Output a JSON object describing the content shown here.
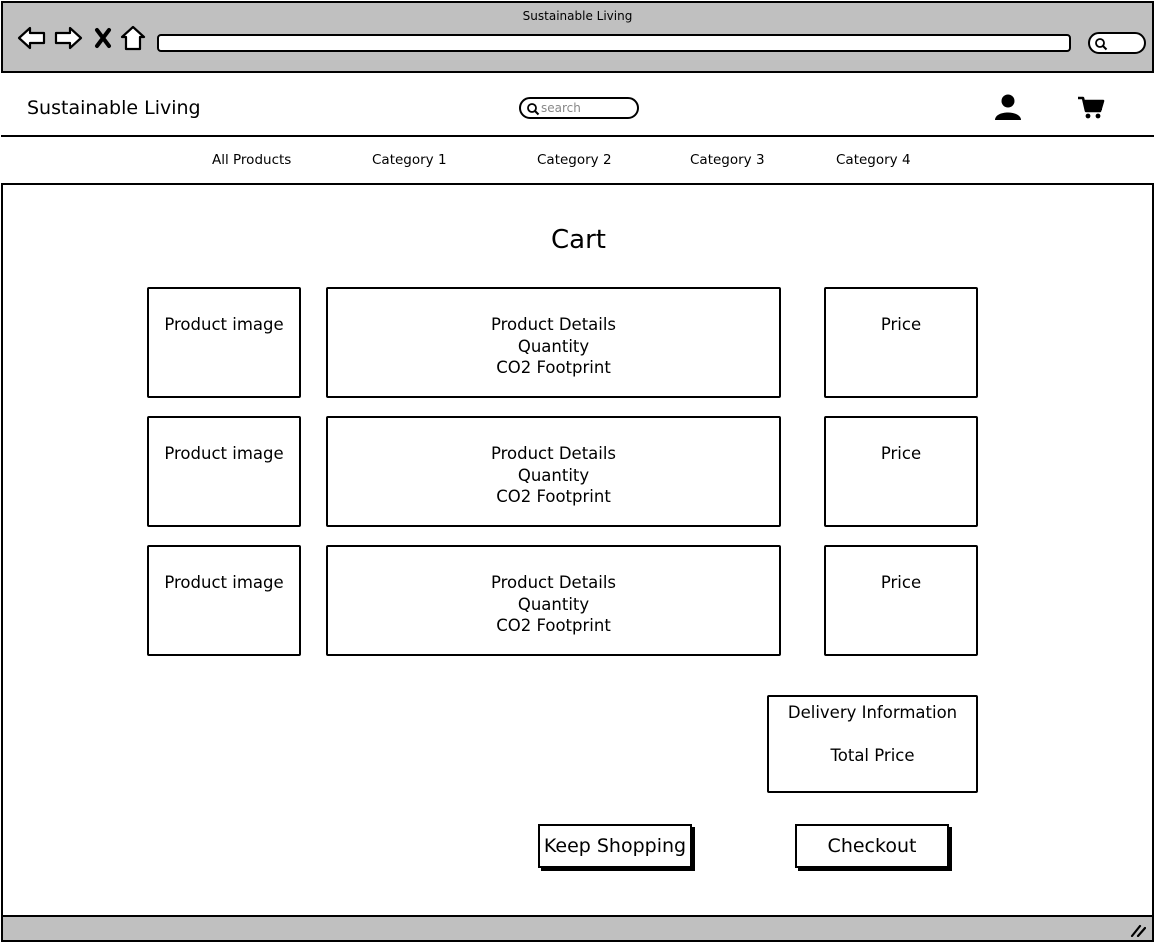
{
  "browser": {
    "window_title": "Sustainable Living",
    "back_icon": "back-arrow-icon",
    "forward_icon": "forward-arrow-icon",
    "stop_icon": "close-x-icon",
    "home_icon": "home-icon",
    "url_value": "",
    "search_icon": "search-icon"
  },
  "header": {
    "brand": "Sustainable Living",
    "search_placeholder": "search",
    "account_icon": "user-icon",
    "cart_icon": "cart-icon"
  },
  "nav": {
    "items": [
      {
        "label": "All Products"
      },
      {
        "label": "Category 1"
      },
      {
        "label": "Category 2"
      },
      {
        "label": "Category 3"
      },
      {
        "label": "Category 4"
      }
    ]
  },
  "cart": {
    "title": "Cart",
    "rows": [
      {
        "image_label": "Product image",
        "details": "Product Details",
        "quantity": "Quantity",
        "footprint": "CO2 Footprint",
        "price": "Price"
      },
      {
        "image_label": "Product image",
        "details": "Product Details",
        "quantity": "Quantity",
        "footprint": "CO2 Footprint",
        "price": "Price"
      },
      {
        "image_label": "Product image",
        "details": "Product Details",
        "quantity": "Quantity",
        "footprint": "CO2 Footprint",
        "price": "Price"
      }
    ],
    "summary": {
      "delivery": "Delivery Information",
      "total": "Total Price"
    },
    "keep_shopping_label": "Keep Shopping",
    "checkout_label": "Checkout"
  },
  "status_bar": {
    "resize_icon": "resize-grip-icon"
  }
}
